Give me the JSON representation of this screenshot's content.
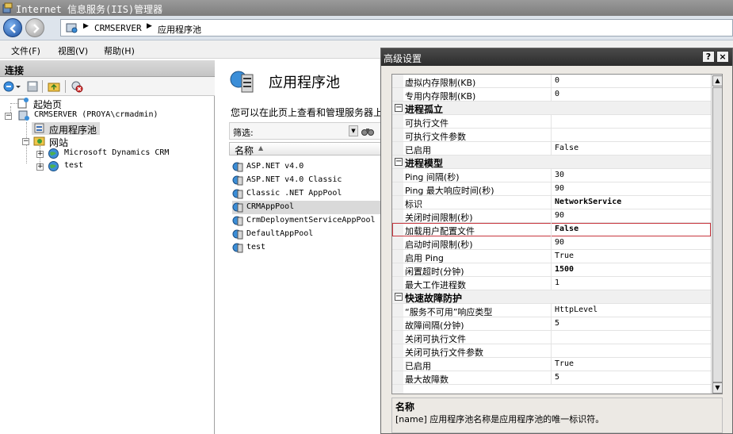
{
  "window": {
    "title": "Internet 信息服务(IIS)管理器"
  },
  "address": {
    "crumbs": [
      "CRMSERVER",
      "应用程序池"
    ]
  },
  "menu": [
    "文件(F)",
    "视图(V)",
    "帮助(H)"
  ],
  "connections": {
    "header": "连接",
    "tree": {
      "start_page": "起始页",
      "server": "CRMSERVER (PROYA\\crmadmin)",
      "app_pools": "应用程序池",
      "sites": "网站",
      "site1": "Microsoft Dynamics CRM",
      "site2": "test"
    }
  },
  "center": {
    "title": "应用程序池",
    "description": "您可以在此页上查看和管理服务器上",
    "filter_label": "筛选:",
    "column_name": "名称",
    "pools": [
      "ASP.NET v4.0",
      "ASP.NET v4.0 Classic",
      "Classic .NET AppPool",
      "CRMAppPool",
      "CrmDeploymentServiceAppPool",
      "DefaultAppPool",
      "test"
    ],
    "selected_pool_index": 3
  },
  "dialog": {
    "title": "高级设置",
    "help_btn": "?",
    "close_btn": "×",
    "rows": [
      {
        "name": "虚拟内存限制(KB)",
        "value": "0",
        "type": "prop"
      },
      {
        "name": "专用内存限制(KB)",
        "value": "0",
        "type": "prop"
      },
      {
        "name": "进程孤立",
        "value": "",
        "type": "cat"
      },
      {
        "name": "可执行文件",
        "value": "",
        "type": "prop"
      },
      {
        "name": "可执行文件参数",
        "value": "",
        "type": "prop"
      },
      {
        "name": "已启用",
        "value": "False",
        "type": "prop"
      },
      {
        "name": "进程模型",
        "value": "",
        "type": "cat"
      },
      {
        "name": "Ping 间隔(秒)",
        "value": "30",
        "type": "prop"
      },
      {
        "name": "Ping 最大响应时间(秒)",
        "value": "90",
        "type": "prop"
      },
      {
        "name": "标识",
        "value": "NetworkService",
        "type": "prop",
        "bold": true
      },
      {
        "name": "关闭时间限制(秒)",
        "value": "90",
        "type": "prop"
      },
      {
        "name": "加载用户配置文件",
        "value": "False",
        "type": "prop",
        "bold": true,
        "highlight": true
      },
      {
        "name": "启动时间限制(秒)",
        "value": "90",
        "type": "prop"
      },
      {
        "name": "启用 Ping",
        "value": "True",
        "type": "prop"
      },
      {
        "name": "闲置超时(分钟)",
        "value": "1500",
        "type": "prop",
        "bold": true
      },
      {
        "name": "最大工作进程数",
        "value": "1",
        "type": "prop"
      },
      {
        "name": "快速故障防护",
        "value": "",
        "type": "cat"
      },
      {
        "name": "“服务不可用”响应类型",
        "value": "HttpLevel",
        "type": "prop"
      },
      {
        "name": "故障间隔(分钟)",
        "value": "5",
        "type": "prop"
      },
      {
        "name": "关闭可执行文件",
        "value": "",
        "type": "prop"
      },
      {
        "name": "关闭可执行文件参数",
        "value": "",
        "type": "prop"
      },
      {
        "name": "已启用",
        "value": "True",
        "type": "prop"
      },
      {
        "name": "最大故障数",
        "value": "5",
        "type": "prop"
      }
    ],
    "desc_title": "名称",
    "desc_text": "[name] 应用程序池名称是应用程序池的唯一标识符。",
    "cat_expander": "⊟"
  },
  "icons": {
    "back": "back-arrow-icon",
    "forward": "forward-arrow-icon"
  }
}
